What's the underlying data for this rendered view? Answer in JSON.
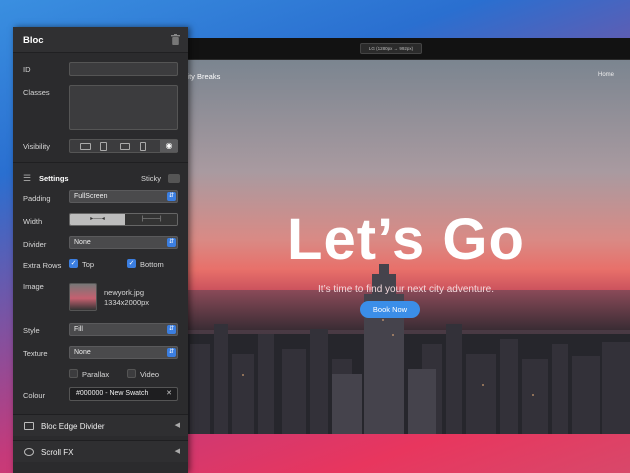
{
  "canvas": {
    "breakpoint_badge": "LG (1280px → 992px)",
    "brand": "City Breaks",
    "nav_home": "Home",
    "headline": "Let’s Go",
    "subheading": "It’s time to find your next city adventure.",
    "cta": "Book Now",
    "scroll_icon": "chevron-down-icon"
  },
  "panel": {
    "title": "Bloc",
    "id_label": "ID",
    "id_value": "",
    "classes_label": "Classes",
    "classes_value": "",
    "visibility_label": "Visibility",
    "settings_title": "Settings",
    "sticky_label": "Sticky",
    "padding_label": "Padding",
    "padding_value": "FullScreen",
    "width_label": "Width",
    "width_options": [
      "▸──◂",
      "|────|"
    ],
    "divider_label": "Divider",
    "divider_value": "None",
    "extra_rows_label": "Extra Rows",
    "top_label": "Top",
    "top_checked": true,
    "bottom_label": "Bottom",
    "bottom_checked": true,
    "image_label": "Image",
    "image_name": "newyork.jpg",
    "image_size": "1334x2000px",
    "style_label": "Style",
    "style_value": "Fill",
    "texture_label": "Texture",
    "texture_value": "None",
    "parallax_label": "Parallax",
    "parallax_checked": false,
    "video_label": "Video",
    "video_checked": false,
    "colour_label": "Colour",
    "colour_value": "#000000 - New Swatch",
    "sections": [
      "Bloc Edge Divider",
      "Scroll FX"
    ]
  }
}
